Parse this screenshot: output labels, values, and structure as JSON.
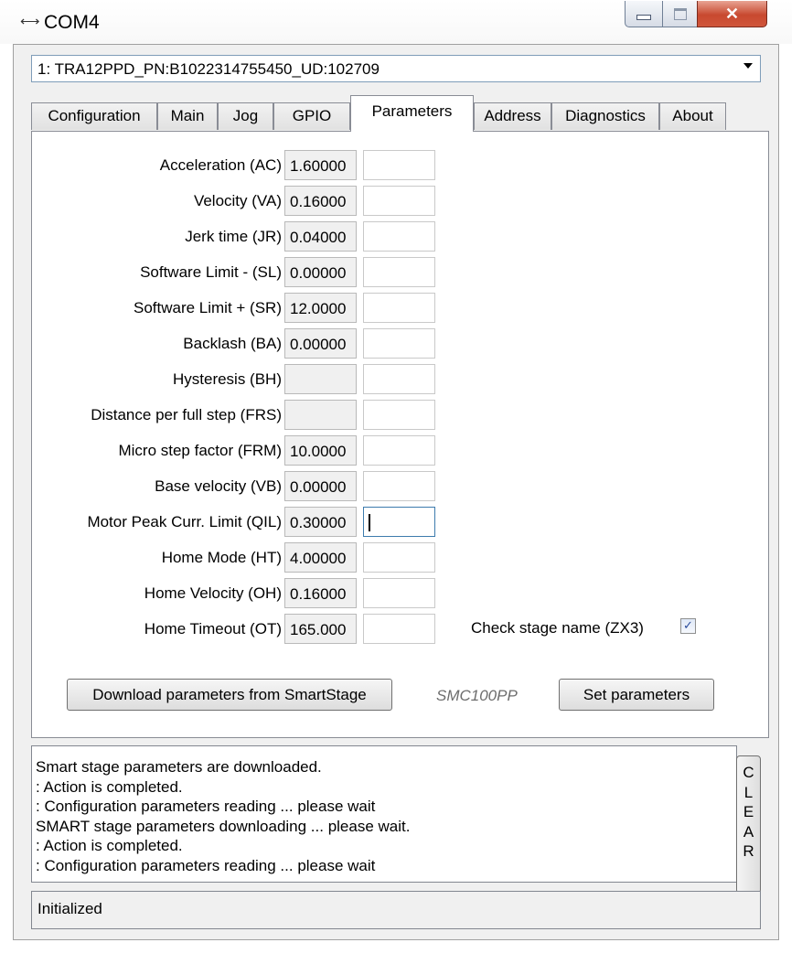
{
  "window": {
    "title": "COM4",
    "link_icon": "⟷"
  },
  "combo": {
    "selected": "1: TRA12PPD_PN:B1022314755450_UD:102709"
  },
  "tabs": [
    {
      "label": "Configuration"
    },
    {
      "label": "Main"
    },
    {
      "label": "Jog"
    },
    {
      "label": "GPIO"
    },
    {
      "label": "Parameters"
    },
    {
      "label": "Address"
    },
    {
      "label": "Diagnostics"
    },
    {
      "label": "About"
    }
  ],
  "active_tab": "Parameters",
  "params": [
    {
      "label": "Acceleration (AC)",
      "value": "1.60000",
      "input": ""
    },
    {
      "label": "Velocity (VA)",
      "value": "0.16000",
      "input": ""
    },
    {
      "label": "Jerk time (JR)",
      "value": "0.04000",
      "input": ""
    },
    {
      "label": "Software Limit - (SL)",
      "value": "0.00000",
      "input": ""
    },
    {
      "label": "Software Limit + (SR)",
      "value": "12.0000",
      "input": ""
    },
    {
      "label": "Backlash (BA)",
      "value": "0.00000",
      "input": ""
    },
    {
      "label": "Hysteresis (BH)",
      "value": "",
      "input": ""
    },
    {
      "label": "Distance per full step (FRS)",
      "value": "",
      "input": ""
    },
    {
      "label": "Micro step factor (FRM)",
      "value": "10.0000",
      "input": ""
    },
    {
      "label": "Base velocity (VB)",
      "value": "0.00000",
      "input": ""
    },
    {
      "label": "Motor Peak Curr. Limit (QIL)",
      "value": "0.30000",
      "input": ""
    },
    {
      "label": "Home Mode (HT)",
      "value": "4.00000",
      "input": ""
    },
    {
      "label": "Home Velocity (OH)",
      "value": "0.16000",
      "input": ""
    },
    {
      "label": "Home Timeout (OT)",
      "value": "165.000",
      "input": ""
    }
  ],
  "check_stage": {
    "label": "Check stage name (ZX3)",
    "checked": true,
    "check_glyph": "✓"
  },
  "buttons": {
    "download": "Download parameters from SmartStage",
    "set": "Set parameters",
    "clear": [
      "C",
      "L",
      "E",
      "A",
      "R"
    ]
  },
  "controller_label": "SMC100PP",
  "log_lines": [
    "Smart stage parameters are downloaded.",
    ": Action is completed.",
    ": Configuration parameters reading ... please wait",
    "SMART stage parameters downloading ... please wait.",
    ": Action is completed.",
    ": Configuration parameters reading ... please wait"
  ],
  "status": "Initialized"
}
